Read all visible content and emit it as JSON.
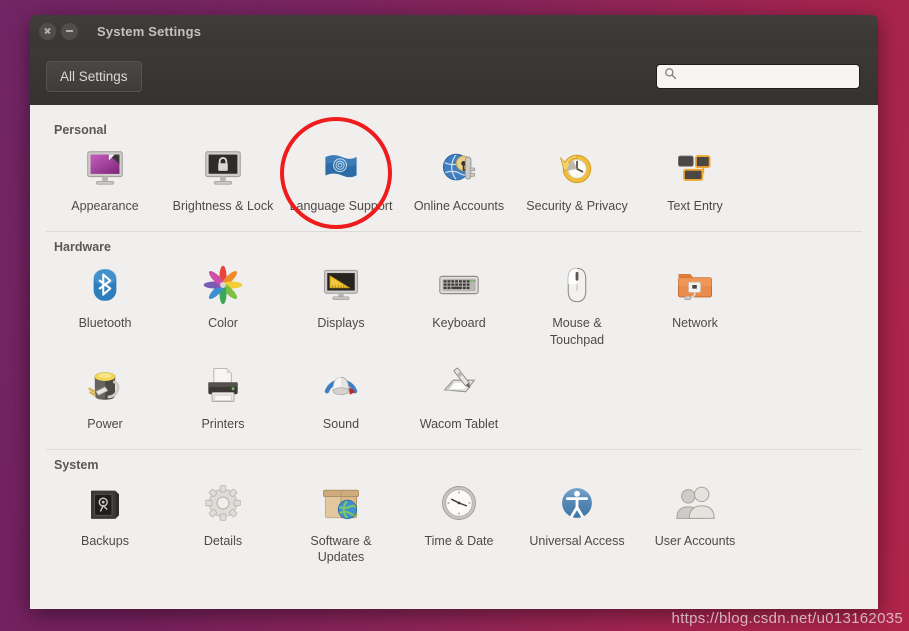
{
  "window": {
    "title": "System Settings",
    "close_label": "Close",
    "minimize_label": "Minimize"
  },
  "toolbar": {
    "all_settings_label": "All Settings",
    "search_placeholder": "",
    "search_value": "",
    "search_icon": "search-icon"
  },
  "sections": [
    {
      "title": "Personal",
      "items": [
        {
          "label": "Appearance",
          "icon": "appearance-icon"
        },
        {
          "label": "Brightness & Lock",
          "icon": "brightness-lock-icon"
        },
        {
          "label": "Language Support",
          "icon": "language-support-icon",
          "highlighted": true
        },
        {
          "label": "Online Accounts",
          "icon": "online-accounts-icon"
        },
        {
          "label": "Security & Privacy",
          "icon": "security-privacy-icon"
        },
        {
          "label": "Text Entry",
          "icon": "text-entry-icon"
        }
      ]
    },
    {
      "title": "Hardware",
      "items": [
        {
          "label": "Bluetooth",
          "icon": "bluetooth-icon"
        },
        {
          "label": "Color",
          "icon": "color-icon"
        },
        {
          "label": "Displays",
          "icon": "displays-icon"
        },
        {
          "label": "Keyboard",
          "icon": "keyboard-icon"
        },
        {
          "label": "Mouse & Touchpad",
          "icon": "mouse-touchpad-icon"
        },
        {
          "label": "Network",
          "icon": "network-icon"
        },
        {
          "label": "Power",
          "icon": "power-icon"
        },
        {
          "label": "Printers",
          "icon": "printers-icon"
        },
        {
          "label": "Sound",
          "icon": "sound-icon"
        },
        {
          "label": "Wacom Tablet",
          "icon": "wacom-tablet-icon"
        }
      ]
    },
    {
      "title": "System",
      "items": [
        {
          "label": "Backups",
          "icon": "backups-icon"
        },
        {
          "label": "Details",
          "icon": "details-icon"
        },
        {
          "label": "Software & Updates",
          "icon": "software-updates-icon"
        },
        {
          "label": "Time & Date",
          "icon": "time-date-icon"
        },
        {
          "label": "Universal Access",
          "icon": "universal-access-icon"
        },
        {
          "label": "User Accounts",
          "icon": "user-accounts-icon"
        }
      ]
    }
  ],
  "annotation": {
    "highlight_color": "#ee1c1c",
    "highlight_target": "Language Support"
  },
  "watermark": "https://blog.csdn.net/u013162035",
  "colors": {
    "desktop_left": "#6a1a5c",
    "desktop_right": "#b02449",
    "titlebar": "#3b3836",
    "content_bg": "#f0efee"
  }
}
